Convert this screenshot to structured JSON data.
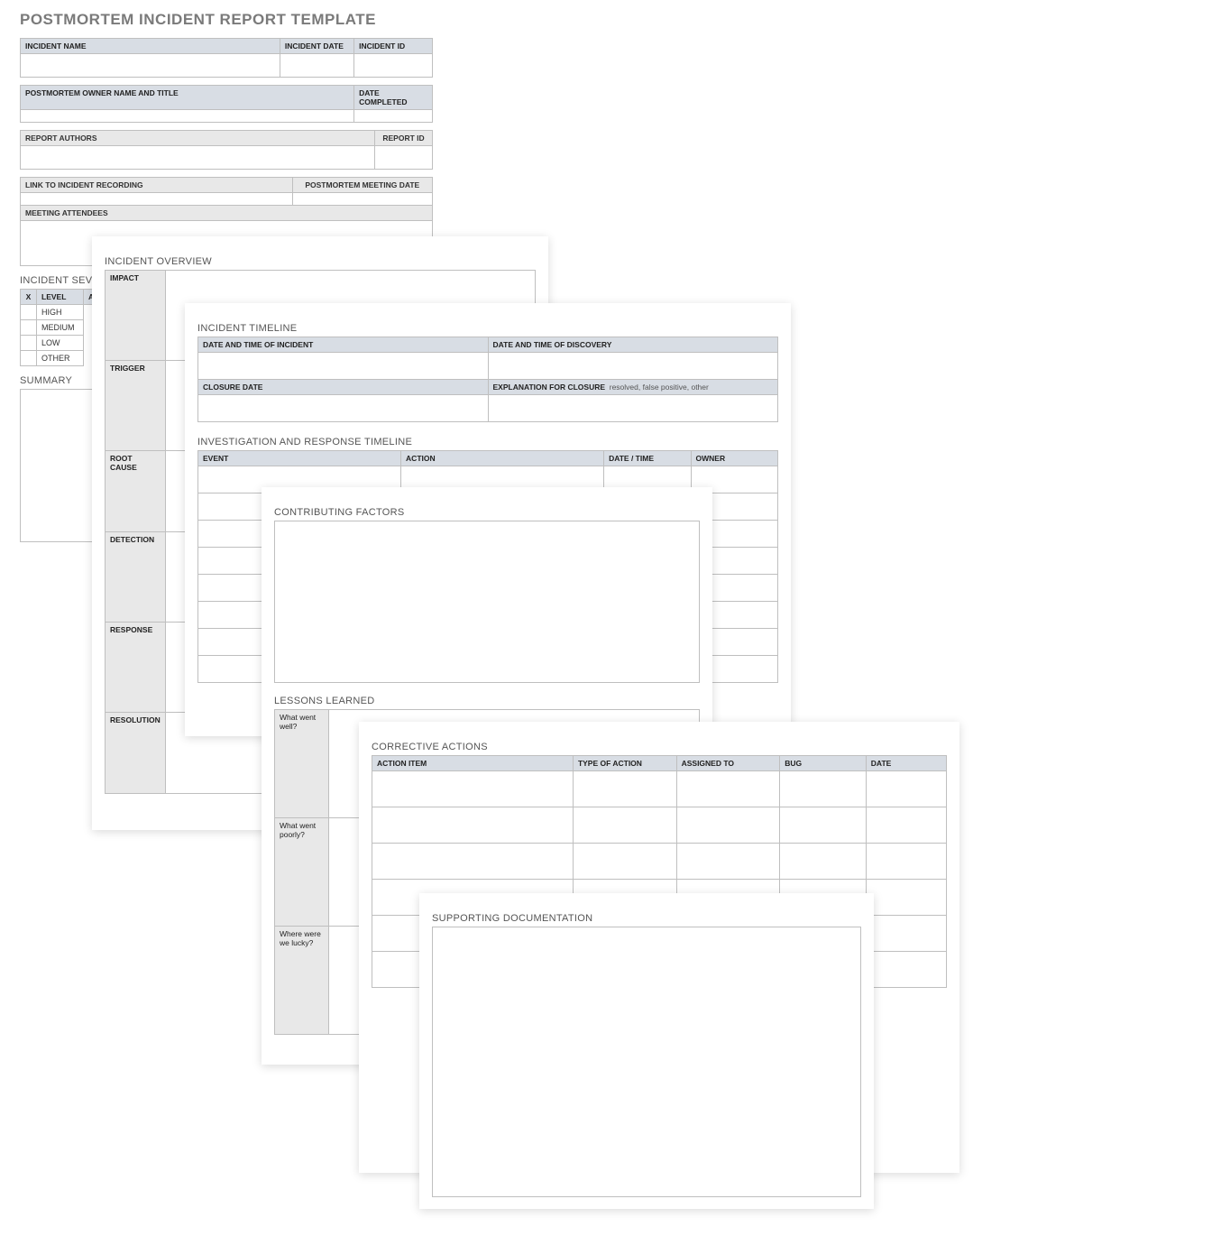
{
  "title": "POSTMORTEM INCIDENT REPORT TEMPLATE",
  "table1": {
    "incident_name": "INCIDENT NAME",
    "incident_date": "INCIDENT DATE",
    "incident_id": "INCIDENT ID"
  },
  "table2": {
    "owner": "POSTMORTEM OWNER NAME AND TITLE",
    "date_completed": "DATE COMPLETED"
  },
  "table3": {
    "authors": "REPORT AUTHORS",
    "report_id": "REPORT ID"
  },
  "table4": {
    "link": "LINK TO INCIDENT RECORDING",
    "meeting_date": "POSTMORTEM MEETING DATE"
  },
  "table5": {
    "attendees": "MEETING ATTENDEES"
  },
  "severity": {
    "title": "INCIDENT SEVERITY",
    "col_x": "X",
    "col_level": "LEVEL",
    "col_add": "ADD",
    "levels": [
      "HIGH",
      "MEDIUM",
      "LOW",
      "OTHER"
    ]
  },
  "summary_title": "SUMMARY",
  "overview": {
    "title": "INCIDENT OVERVIEW",
    "rows": [
      "IMPACT",
      "TRIGGER",
      "ROOT CAUSE",
      "DETECTION",
      "RESPONSE",
      "RESOLUTION"
    ]
  },
  "timeline": {
    "title": "INCIDENT TIMELINE",
    "dt_incident": "DATE AND TIME OF INCIDENT",
    "dt_discovery": "DATE AND TIME OF DISCOVERY",
    "closure_date": "CLOSURE DATE",
    "closure_exp": "EXPLANATION FOR CLOSURE",
    "closure_hint": "resolved, false positive, other"
  },
  "investigation": {
    "title": "INVESTIGATION AND RESPONSE TIMELINE",
    "cols": [
      "EVENT",
      "ACTION",
      "DATE / TIME",
      "OWNER"
    ]
  },
  "contributing": {
    "title": "CONTRIBUTING FACTORS"
  },
  "lessons": {
    "title": "LESSONS LEARNED",
    "rows": [
      "What went well?",
      "What went poorly?",
      "Where were we lucky?"
    ]
  },
  "corrective": {
    "title": "CORRECTIVE ACTIONS",
    "cols": [
      "ACTION ITEM",
      "TYPE OF ACTION",
      "ASSIGNED TO",
      "BUG",
      "DATE"
    ]
  },
  "supporting": {
    "title": "SUPPORTING DOCUMENTATION"
  }
}
